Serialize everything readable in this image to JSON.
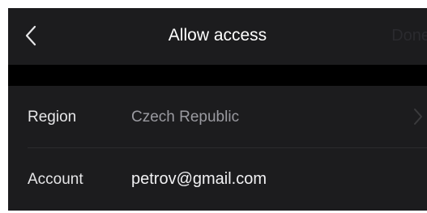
{
  "nav": {
    "title": "Allow access",
    "done_label": "Done",
    "back_icon": "chevron-left-icon"
  },
  "form": {
    "rows": [
      {
        "label": "Region",
        "value": "Czech Republic",
        "icon": "chevron-right-icon"
      },
      {
        "label": "Account",
        "value": "petrov@gmail.com"
      }
    ]
  },
  "colors": {
    "background": "#000000",
    "surface": "#1c1c1e",
    "text_primary": "#ffffff",
    "text_secondary": "#9a9aa0",
    "done_disabled": "#2a2a2e"
  }
}
